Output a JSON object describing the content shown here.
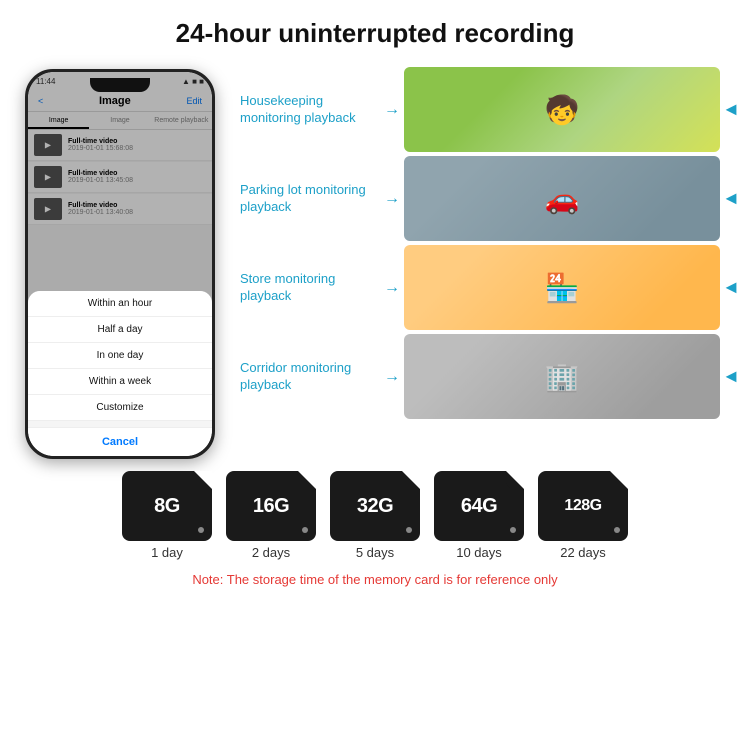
{
  "header": {
    "title": "24-hour uninterrupted recording"
  },
  "phone": {
    "status_time": "11:44",
    "nav_title": "Image",
    "nav_back": "<",
    "nav_edit": "Edit",
    "tabs": [
      "Image",
      "Image",
      "Remote playback"
    ],
    "videos": [
      {
        "name": "Full-time video",
        "time": "2019-01-01 15:68:08"
      },
      {
        "name": "Full-time video",
        "time": "2019-01-01 13:45:08"
      },
      {
        "name": "Full-time video",
        "time": "2019-01-01 13:40:08"
      }
    ],
    "modal_items": [
      "Within an hour",
      "Half a day",
      "In one day",
      "Within a week",
      "Customize"
    ],
    "modal_cancel": "Cancel"
  },
  "monitoring": [
    {
      "label": "Housekeeping monitoring playback",
      "img_class": "img-housekeeping"
    },
    {
      "label": "Parking lot monitoring playback",
      "img_class": "img-parking"
    },
    {
      "label": "Store monitoring playback",
      "img_class": "img-store"
    },
    {
      "label": "Corridor monitoring playback",
      "img_class": "img-corridor"
    }
  ],
  "sdcards": [
    {
      "size": "8G",
      "days": "1 day"
    },
    {
      "size": "16G",
      "days": "2 days"
    },
    {
      "size": "32G",
      "days": "5 days"
    },
    {
      "size": "64G",
      "days": "10 days"
    },
    {
      "size": "128G",
      "days": "22 days"
    }
  ],
  "note": "Note: The storage time of the memory card is for reference only",
  "colors": {
    "accent": "#1da0c8",
    "note_color": "#e53935",
    "phone_bg": "#111",
    "sdcard_bg": "#1a1a1a"
  }
}
